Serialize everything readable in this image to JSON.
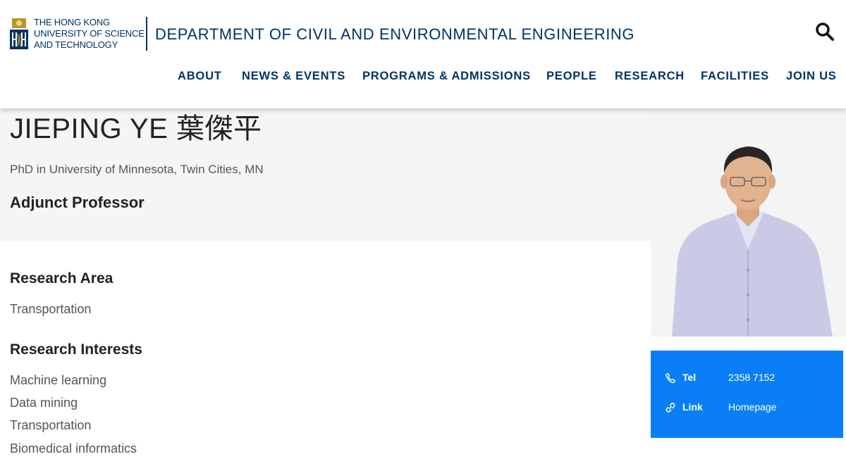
{
  "header": {
    "logo_lines": [
      "THE HONG KONG",
      "UNIVERSITY OF SCIENCE",
      "AND TECHNOLOGY"
    ],
    "department_title": "DEPARTMENT OF CIVIL AND ENVIRONMENTAL ENGINEERING",
    "search_icon": "search-icon",
    "nav": [
      "ABOUT",
      "NEWS & EVENTS",
      "PROGRAMS & ADMISSIONS",
      "PEOPLE",
      "RESEARCH",
      "FACILITIES",
      "JOIN US"
    ]
  },
  "profile": {
    "name": "JIEPING YE 葉傑平",
    "degree": "PhD in University of Minnesota, Twin Cities, MN",
    "position": "Adjunct Professor"
  },
  "research_area": {
    "title": "Research Area",
    "items": [
      "Transportation"
    ]
  },
  "research_interests": {
    "title": "Research Interests",
    "items": [
      "Machine learning",
      "Data mining",
      "Transportation",
      "Biomedical informatics"
    ]
  },
  "contact": {
    "tel_label": "Tel",
    "tel_value": "2358 7152",
    "tel_icon": "phone-icon",
    "link_label": "Link",
    "link_value": "Homepage",
    "link_icon": "link-icon"
  },
  "colors": {
    "brand_navy": "#003366",
    "contact_blue": "#0a7ff5",
    "band_gray": "#f5f5f5"
  }
}
